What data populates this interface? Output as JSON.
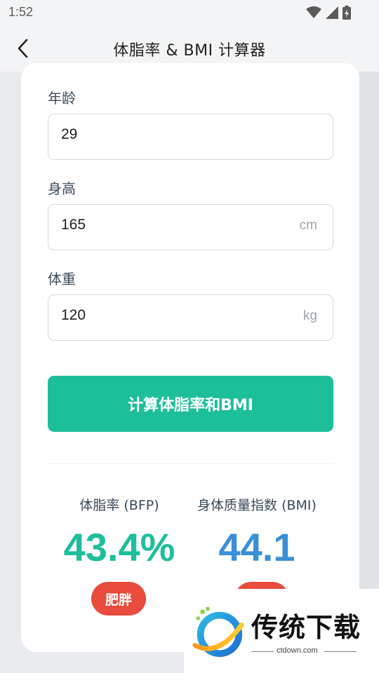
{
  "status": {
    "time": "1:52"
  },
  "appbar": {
    "title": "体脂率 & BMI 计算器"
  },
  "form": {
    "age": {
      "label": "年龄",
      "value": "29"
    },
    "height": {
      "label": "身高",
      "value": "165",
      "unit": "cm"
    },
    "weight": {
      "label": "体重",
      "value": "120",
      "unit": "kg"
    },
    "button_label": "计算体脂率和BMI"
  },
  "results": {
    "bfp": {
      "title": "体脂率 (BFP)",
      "value": "43.4%",
      "badge": "肥胖",
      "color": "#1dbf9b"
    },
    "bmi": {
      "title": "身体质量指数 (BMI)",
      "value": "44.1",
      "color": "#3a8fd8"
    }
  },
  "colors": {
    "accent": "#1dbf9b",
    "badge": "#e94b3c"
  },
  "watermark": {
    "name": "传统下载",
    "url": "ctdown.com"
  }
}
